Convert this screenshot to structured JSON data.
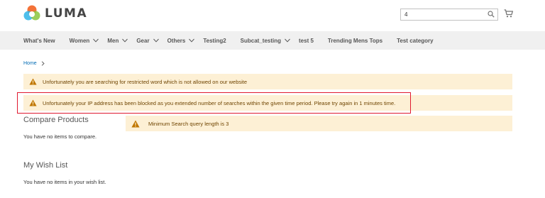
{
  "header": {
    "logo_text": "LUMA",
    "search_value": "4",
    "search_icon": "search-icon",
    "cart_icon": "cart-icon"
  },
  "nav": {
    "items": [
      {
        "label": "What's New",
        "has_dropdown": false
      },
      {
        "label": "Women",
        "has_dropdown": true
      },
      {
        "label": "Men",
        "has_dropdown": true
      },
      {
        "label": "Gear",
        "has_dropdown": true
      },
      {
        "label": "Others",
        "has_dropdown": true
      },
      {
        "label": "Testing2",
        "has_dropdown": false
      },
      {
        "label": "Subcat_testing",
        "has_dropdown": true
      },
      {
        "label": "test 5",
        "has_dropdown": false
      },
      {
        "label": "Trending Mens Tops",
        "has_dropdown": false
      },
      {
        "label": "Test category",
        "has_dropdown": false
      }
    ]
  },
  "breadcrumb": {
    "home": "Home"
  },
  "messages": {
    "restricted_word": "Unfortunately you are searching for restricted word which is not allowed on our website",
    "ip_blocked": "Unfortunately your IP address has been blocked as you extended number of searches within the given time period. Please try again in 1 minutes time.",
    "min_length": "Minimum Search query length is 3"
  },
  "sidebar": {
    "compare_title": "Compare Products",
    "compare_empty": "You have no items to compare.",
    "wishlist_title": "My Wish List",
    "wishlist_empty": "You have no items in your wish list."
  },
  "colors": {
    "brand_orange": "#f26322",
    "link_blue": "#006bb4",
    "warning_bg": "#fdf0d5",
    "warning_text": "#6f4400",
    "warning_icon": "#c07600",
    "highlight_red": "#e0192f",
    "nav_bg": "#f0f0f0"
  }
}
